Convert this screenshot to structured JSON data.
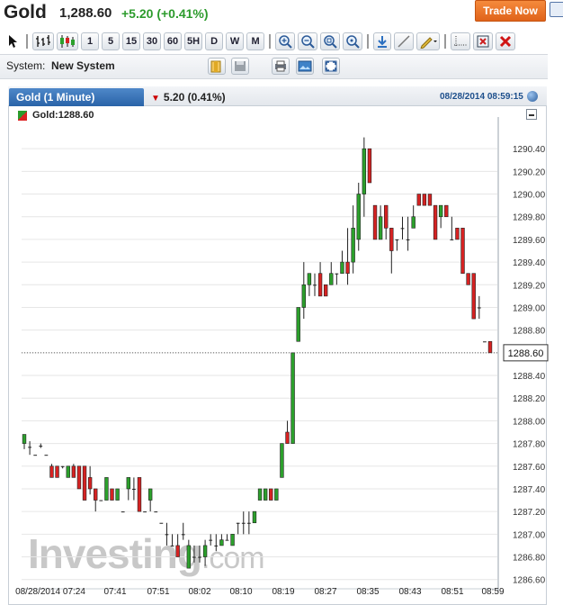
{
  "header": {
    "name": "Gold",
    "price": "1,288.60",
    "change": "+5.20 (+0.41%)",
    "trade_button": "Trade Now"
  },
  "toolbar": {
    "buttons": [
      "1",
      "5",
      "15",
      "30",
      "60",
      "5H",
      "D",
      "W",
      "M"
    ]
  },
  "system": {
    "label": "System:",
    "value": "New System"
  },
  "chart_panel": {
    "tab_title": "Gold (1 Minute)",
    "tab_change": "5.20 (0.41%)",
    "timestamp": "08/28/2014 08:59:15",
    "series_label": "Gold:1288.60",
    "last_price_tag": "1288.60",
    "watermark_main": "Investing",
    "watermark_suffix": ".com"
  },
  "colors": {
    "up": "#2ca02c",
    "down": "#d62222",
    "accent": "#2963a8",
    "trade_button": "#ee7a2e"
  },
  "chart_data": {
    "type": "candlestick",
    "ylim": [
      1286.55,
      1290.6
    ],
    "y_ticks": [
      "1290.40",
      "1290.20",
      "1290.00",
      "1289.80",
      "1289.60",
      "1289.40",
      "1289.20",
      "1289.00",
      "1288.80",
      "1288.60",
      "1288.40",
      "1288.20",
      "1288.00",
      "1287.80",
      "1287.60",
      "1287.40",
      "1287.20",
      "1287.00",
      "1286.80",
      "1286.60"
    ],
    "x_labels": [
      "08/28/2014 07:24",
      "07:41",
      "07:51",
      "08:02",
      "08:10",
      "08:19",
      "08:27",
      "08:35",
      "08:43",
      "08:51",
      "08:59"
    ],
    "last_price": 1288.6,
    "candles": [
      {
        "o": 1287.8,
        "h": 1287.88,
        "l": 1287.75,
        "c": 1287.88
      },
      {
        "o": 1287.77,
        "h": 1287.82,
        "l": 1287.7,
        "c": 1287.77
      },
      {
        "o": 1287.7,
        "h": 1287.7,
        "l": 1287.7,
        "c": 1287.7
      },
      {
        "o": 1287.78,
        "h": 1287.8,
        "l": 1287.76,
        "c": 1287.78
      },
      {
        "o": 1287.7,
        "h": 1287.7,
        "l": 1287.7,
        "c": 1287.7
      },
      {
        "o": 1287.6,
        "h": 1287.62,
        "l": 1287.5,
        "c": 1287.5
      },
      {
        "o": 1287.6,
        "h": 1287.6,
        "l": 1287.5,
        "c": 1287.5
      },
      {
        "o": 1287.6,
        "h": 1287.6,
        "l": 1287.58,
        "c": 1287.6
      },
      {
        "o": 1287.5,
        "h": 1287.6,
        "l": 1287.5,
        "c": 1287.6
      },
      {
        "o": 1287.6,
        "h": 1287.62,
        "l": 1287.5,
        "c": 1287.5
      },
      {
        "o": 1287.6,
        "h": 1287.6,
        "l": 1287.4,
        "c": 1287.4
      },
      {
        "o": 1287.6,
        "h": 1287.6,
        "l": 1287.3,
        "c": 1287.3
      },
      {
        "o": 1287.5,
        "h": 1287.6,
        "l": 1287.35,
        "c": 1287.4
      },
      {
        "o": 1287.4,
        "h": 1287.4,
        "l": 1287.2,
        "c": 1287.3
      },
      {
        "o": 1287.3,
        "h": 1287.3,
        "l": 1287.3,
        "c": 1287.3
      },
      {
        "o": 1287.3,
        "h": 1287.5,
        "l": 1287.3,
        "c": 1287.5
      },
      {
        "o": 1287.4,
        "h": 1287.4,
        "l": 1287.3,
        "c": 1287.3
      },
      {
        "o": 1287.3,
        "h": 1287.4,
        "l": 1287.3,
        "c": 1287.4
      },
      {
        "o": 1287.2,
        "h": 1287.2,
        "l": 1287.2,
        "c": 1287.2
      },
      {
        "o": 1287.4,
        "h": 1287.5,
        "l": 1287.3,
        "c": 1287.5
      },
      {
        "o": 1287.4,
        "h": 1287.5,
        "l": 1287.3,
        "c": 1287.4
      },
      {
        "o": 1287.5,
        "h": 1287.5,
        "l": 1287.2,
        "c": 1287.2
      },
      {
        "o": 1287.2,
        "h": 1287.2,
        "l": 1287.2,
        "c": 1287.2
      },
      {
        "o": 1287.3,
        "h": 1287.4,
        "l": 1287.2,
        "c": 1287.4
      },
      {
        "o": 1287.2,
        "h": 1287.2,
        "l": 1287.2,
        "c": 1287.2
      },
      {
        "o": 1287.1,
        "h": 1287.1,
        "l": 1287.1,
        "c": 1287.1
      },
      {
        "o": 1287.0,
        "h": 1287.1,
        "l": 1286.9,
        "c": 1287.0
      },
      {
        "o": 1286.9,
        "h": 1287.0,
        "l": 1286.9,
        "c": 1286.9
      },
      {
        "o": 1286.9,
        "h": 1287.0,
        "l": 1286.8,
        "c": 1286.8
      },
      {
        "o": 1287.0,
        "h": 1287.1,
        "l": 1286.95,
        "c": 1287.0
      },
      {
        "o": 1286.7,
        "h": 1286.95,
        "l": 1286.7,
        "c": 1286.9
      },
      {
        "o": 1286.8,
        "h": 1286.9,
        "l": 1286.75,
        "c": 1286.8
      },
      {
        "o": 1286.8,
        "h": 1286.9,
        "l": 1286.75,
        "c": 1286.8
      },
      {
        "o": 1286.8,
        "h": 1286.95,
        "l": 1286.72,
        "c": 1286.9
      },
      {
        "o": 1286.95,
        "h": 1287.0,
        "l": 1286.9,
        "c": 1286.95
      },
      {
        "o": 1286.9,
        "h": 1287.0,
        "l": 1286.85,
        "c": 1286.9
      },
      {
        "o": 1286.9,
        "h": 1287.0,
        "l": 1286.9,
        "c": 1286.95
      },
      {
        "o": 1286.95,
        "h": 1287.0,
        "l": 1286.95,
        "c": 1286.95
      },
      {
        "o": 1286.9,
        "h": 1287.0,
        "l": 1286.9,
        "c": 1287.0
      },
      {
        "o": 1287.1,
        "h": 1287.1,
        "l": 1287.0,
        "c": 1287.1
      },
      {
        "o": 1287.1,
        "h": 1287.2,
        "l": 1287.0,
        "c": 1287.1
      },
      {
        "o": 1287.1,
        "h": 1287.2,
        "l": 1287.0,
        "c": 1287.1
      },
      {
        "o": 1287.1,
        "h": 1287.2,
        "l": 1287.1,
        "c": 1287.2
      },
      {
        "o": 1287.3,
        "h": 1287.4,
        "l": 1287.3,
        "c": 1287.4
      },
      {
        "o": 1287.3,
        "h": 1287.4,
        "l": 1287.3,
        "c": 1287.4
      },
      {
        "o": 1287.4,
        "h": 1287.4,
        "l": 1287.3,
        "c": 1287.3
      },
      {
        "o": 1287.3,
        "h": 1287.4,
        "l": 1287.3,
        "c": 1287.4
      },
      {
        "o": 1287.5,
        "h": 1287.8,
        "l": 1287.5,
        "c": 1287.8
      },
      {
        "o": 1287.9,
        "h": 1288.0,
        "l": 1287.8,
        "c": 1287.8
      },
      {
        "o": 1287.8,
        "h": 1288.6,
        "l": 1287.8,
        "c": 1288.6
      },
      {
        "o": 1288.7,
        "h": 1289.0,
        "l": 1288.7,
        "c": 1289.0
      },
      {
        "o": 1289.0,
        "h": 1289.4,
        "l": 1288.9,
        "c": 1289.2
      },
      {
        "o": 1289.2,
        "h": 1289.3,
        "l": 1289.1,
        "c": 1289.3
      },
      {
        "o": 1289.2,
        "h": 1289.3,
        "l": 1289.1,
        "c": 1289.2
      },
      {
        "o": 1289.3,
        "h": 1289.4,
        "l": 1289.1,
        "c": 1289.1
      },
      {
        "o": 1289.2,
        "h": 1289.2,
        "l": 1289.1,
        "c": 1289.1
      },
      {
        "o": 1289.2,
        "h": 1289.4,
        "l": 1289.2,
        "c": 1289.3
      },
      {
        "o": 1289.3,
        "h": 1289.3,
        "l": 1289.2,
        "c": 1289.3
      },
      {
        "o": 1289.3,
        "h": 1289.5,
        "l": 1289.3,
        "c": 1289.4
      },
      {
        "o": 1289.4,
        "h": 1289.7,
        "l": 1289.2,
        "c": 1289.3
      },
      {
        "o": 1289.4,
        "h": 1289.9,
        "l": 1289.3,
        "c": 1289.7
      },
      {
        "o": 1289.6,
        "h": 1290.1,
        "l": 1289.5,
        "c": 1290.0
      },
      {
        "o": 1290.0,
        "h": 1290.5,
        "l": 1289.8,
        "c": 1290.4
      },
      {
        "o": 1290.4,
        "h": 1290.3,
        "l": 1290.1,
        "c": 1290.1
      },
      {
        "o": 1289.9,
        "h": 1289.9,
        "l": 1289.6,
        "c": 1289.6
      },
      {
        "o": 1289.6,
        "h": 1289.9,
        "l": 1289.6,
        "c": 1289.8
      },
      {
        "o": 1289.9,
        "h": 1289.9,
        "l": 1289.6,
        "c": 1289.7
      },
      {
        "o": 1289.7,
        "h": 1289.7,
        "l": 1289.3,
        "c": 1289.5
      },
      {
        "o": 1289.6,
        "h": 1289.6,
        "l": 1289.5,
        "c": 1289.6
      },
      {
        "o": 1289.7,
        "h": 1289.8,
        "l": 1289.6,
        "c": 1289.7
      },
      {
        "o": 1289.6,
        "h": 1289.8,
        "l": 1289.5,
        "c": 1289.6
      },
      {
        "o": 1289.7,
        "h": 1289.9,
        "l": 1289.7,
        "c": 1289.8
      },
      {
        "o": 1290.0,
        "h": 1290.0,
        "l": 1289.9,
        "c": 1289.9
      },
      {
        "o": 1290.0,
        "h": 1290.0,
        "l": 1289.9,
        "c": 1289.9
      },
      {
        "o": 1290.0,
        "h": 1290.0,
        "l": 1289.9,
        "c": 1289.9
      },
      {
        "o": 1289.9,
        "h": 1289.9,
        "l": 1289.6,
        "c": 1289.6
      },
      {
        "o": 1289.8,
        "h": 1289.9,
        "l": 1289.7,
        "c": 1289.9
      },
      {
        "o": 1289.9,
        "h": 1289.9,
        "l": 1289.8,
        "c": 1289.8
      },
      {
        "o": 1289.6,
        "h": 1289.8,
        "l": 1289.6,
        "c": 1289.6
      },
      {
        "o": 1289.7,
        "h": 1289.7,
        "l": 1289.6,
        "c": 1289.6
      },
      {
        "o": 1289.7,
        "h": 1289.7,
        "l": 1289.3,
        "c": 1289.3
      },
      {
        "o": 1289.3,
        "h": 1289.3,
        "l": 1289.2,
        "c": 1289.2
      },
      {
        "o": 1289.3,
        "h": 1289.3,
        "l": 1288.9,
        "c": 1288.9
      },
      {
        "o": 1289.0,
        "h": 1289.1,
        "l": 1288.9,
        "c": 1289.0
      },
      {
        "o": 1288.7,
        "h": 1288.7,
        "l": 1288.7,
        "c": 1288.7
      },
      {
        "o": 1288.7,
        "h": 1288.7,
        "l": 1288.6,
        "c": 1288.6
      }
    ]
  }
}
